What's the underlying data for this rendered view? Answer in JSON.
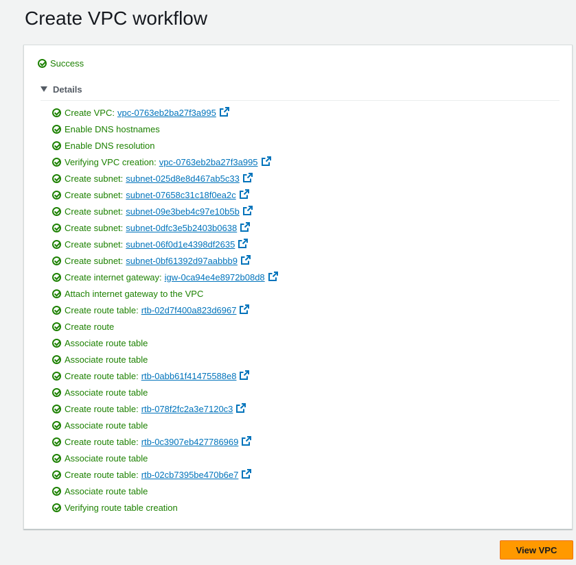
{
  "page": {
    "title": "Create VPC workflow"
  },
  "status": {
    "label": "Success",
    "icon": "check-circle-icon",
    "color": "#1d8102"
  },
  "details": {
    "label": "Details",
    "expanded": true
  },
  "steps": [
    {
      "label": "Create VPC:",
      "resource": "vpc-0763eb2ba27f3a995"
    },
    {
      "label": "Enable DNS hostnames"
    },
    {
      "label": "Enable DNS resolution"
    },
    {
      "label": "Verifying VPC creation:",
      "resource": "vpc-0763eb2ba27f3a995"
    },
    {
      "label": "Create subnet:",
      "resource": "subnet-025d8e8d467ab5c33"
    },
    {
      "label": "Create subnet:",
      "resource": "subnet-07658c31c18f0ea2c"
    },
    {
      "label": "Create subnet:",
      "resource": "subnet-09e3beb4c97e10b5b"
    },
    {
      "label": "Create subnet:",
      "resource": "subnet-0dfc3e5b2403b0638"
    },
    {
      "label": "Create subnet:",
      "resource": "subnet-06f0d1e4398df2635"
    },
    {
      "label": "Create subnet:",
      "resource": "subnet-0bf61392d97aabbb9"
    },
    {
      "label": "Create internet gateway:",
      "resource": "igw-0ca94e4e8972b08d8"
    },
    {
      "label": "Attach internet gateway to the VPC"
    },
    {
      "label": "Create route table:",
      "resource": "rtb-02d7f400a823d6967"
    },
    {
      "label": "Create route"
    },
    {
      "label": "Associate route table"
    },
    {
      "label": "Associate route table"
    },
    {
      "label": "Create route table:",
      "resource": "rtb-0abb61f41475588e8"
    },
    {
      "label": "Associate route table"
    },
    {
      "label": "Create route table:",
      "resource": "rtb-078f2fc2a3e7120c3"
    },
    {
      "label": "Associate route table"
    },
    {
      "label": "Create route table:",
      "resource": "rtb-0c3907eb427786969"
    },
    {
      "label": "Associate route table"
    },
    {
      "label": "Create route table:",
      "resource": "rtb-02cb7395be470b6e7"
    },
    {
      "label": "Associate route table"
    },
    {
      "label": "Verifying route table creation"
    }
  ],
  "footer": {
    "view_vpc_label": "View VPC",
    "accent_color": "#ff9900"
  },
  "colors": {
    "success": "#1d8102",
    "link": "#0073bb",
    "title": "#16191f"
  }
}
